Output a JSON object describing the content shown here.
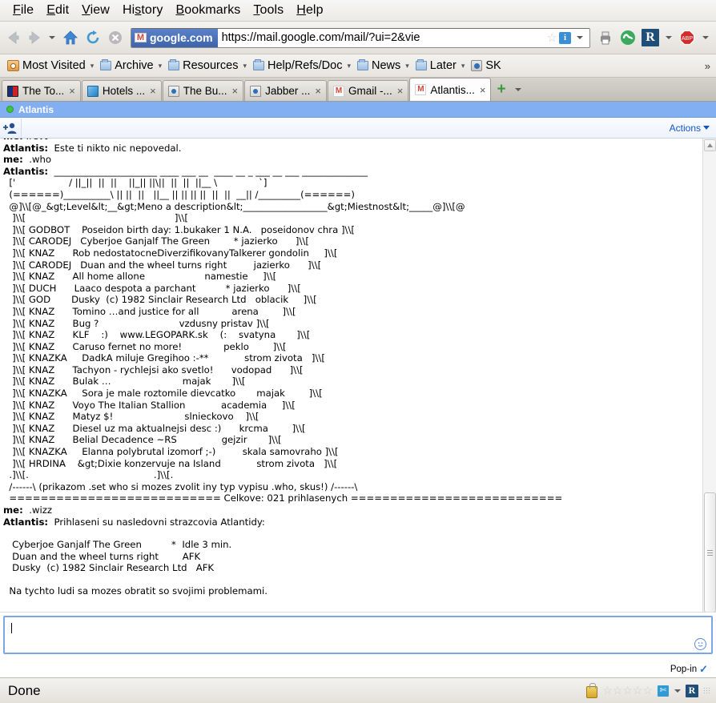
{
  "browser": {
    "menu": [
      "File",
      "Edit",
      "View",
      "History",
      "Bookmarks",
      "Tools",
      "Help"
    ],
    "url_identity": "google.com",
    "url": "https://mail.google.com/mail/?ui=2&vie",
    "bookmarks": [
      {
        "label": "Most Visited",
        "icon": "most-visited-icon",
        "caret": true
      },
      {
        "label": "Archive",
        "icon": "folder-icon",
        "caret": true
      },
      {
        "label": "Resources",
        "icon": "folder-icon",
        "caret": true
      },
      {
        "label": "Help/Refs/Doc",
        "icon": "folder-icon",
        "caret": true
      },
      {
        "label": "News",
        "icon": "folder-icon",
        "caret": true
      },
      {
        "label": "Later",
        "icon": "folder-icon",
        "caret": true
      },
      {
        "label": "SK",
        "icon": "site-icon",
        "caret": false
      }
    ],
    "bookmarks_overflow": "»",
    "tabs": [
      {
        "label": "The To...",
        "favicon": "tor-icon",
        "active": false
      },
      {
        "label": "Hotels ...",
        "favicon": "hotels-icon",
        "active": false
      },
      {
        "label": "The Bu...",
        "favicon": "generic-site-icon",
        "active": false
      },
      {
        "label": "Jabber ...",
        "favicon": "generic-site-icon",
        "active": false
      },
      {
        "label": "Gmail -...",
        "favicon": "gmail-icon",
        "active": false
      },
      {
        "label": "Atlantis...",
        "favicon": "gmail-icon",
        "active": true
      }
    ],
    "tab_close_glyph": "×",
    "new_tab_glyph": "+",
    "toolbar_buttons": [
      "print-icon",
      "stumbleupon-icon",
      "readability-icon",
      "adblock-plus-icon"
    ],
    "status": "Done"
  },
  "chat": {
    "title": "Atlantis",
    "presence": "online",
    "actions_label": "Actions",
    "invite_icon": "add-contact-icon",
    "popin_label": "Pop-in",
    "input_value": "",
    "input_placeholder": "",
    "smiley_icon": "emoticon-icon",
    "messages": [
      {
        "type": "msg",
        "who": "me:",
        "text": " .revt",
        "clipped": true
      },
      {
        "type": "msg",
        "who": "Atlantis:",
        "text": "  Este ti nikto nic nepovedal."
      },
      {
        "type": "msg",
        "who": "me:",
        "text": "  .who"
      },
      {
        "type": "msg",
        "who": "Atlantis:",
        "text": "  ______________________ ____ ___ __  ____ __ _ ___ __ ___ ______________"
      },
      {
        "type": "raw",
        "text": "  ['                  / ||_||  ||  ||    ||_|| ||\\||  ||  ||  ||__ \\              `]"
      },
      {
        "type": "raw",
        "text": "  (======)__________\\ || ||  ||   ||__ || || || ||  ||  ||  __|| /_________(======)"
      },
      {
        "type": "raw",
        "text": "  @]\\\\[@_&gt;Level&lt;__&gt;Meno a description&lt;__________________&gt;Miestnost&lt;_____@]\\\\[@"
      },
      {
        "type": "raw",
        "text": "   ]\\\\[                                                  ]\\\\["
      },
      {
        "type": "raw",
        "text": "   ]\\\\[ GODBOT    Poseidon birth day: 1.bukaker 1 N.A.   poseidonov chra ]\\\\["
      },
      {
        "type": "raw",
        "text": "   ]\\\\[ CARODEJ   Cyberjoe Ganjalf The Green        * jazierko      ]\\\\["
      },
      {
        "type": "raw",
        "text": "   ]\\\\[ KNAZ      Rob nedostatocneDiverzifikovanyTalkerer gondolin     ]\\\\["
      },
      {
        "type": "raw",
        "text": "   ]\\\\[ CARODEJ   Duan and the wheel turns right         jazierko      ]\\\\["
      },
      {
        "type": "raw",
        "text": "   ]\\\\[ KNAZ      All home allone                    namestie     ]\\\\["
      },
      {
        "type": "raw",
        "text": "   ]\\\\[ DUCH      Laaco despota a parchant          * jazierko      ]\\\\["
      },
      {
        "type": "raw",
        "text": "   ]\\\\[ GOD       Dusky  (c) 1982 Sinclair Research Ltd   oblacik     ]\\\\["
      },
      {
        "type": "raw",
        "text": "   ]\\\\[ KNAZ      Tomino …and justice for all           arena        ]\\\\["
      },
      {
        "type": "raw",
        "text": "   ]\\\\[ KNAZ      Bug ?                           vzdusny pristav ]\\\\["
      },
      {
        "type": "raw",
        "text": "   ]\\\\[ KNAZ      KLF    :)    www.LEGOPARK.sk    (:    svatyna       ]\\\\["
      },
      {
        "type": "raw",
        "text": "   ]\\\\[ KNAZ      Caruso fernet no more!              peklo        ]\\\\["
      },
      {
        "type": "raw",
        "text": "   ]\\\\[ KNAZKA     DadkA miluje Gregihoo :-**            strom zivota   ]\\\\["
      },
      {
        "type": "raw",
        "text": "   ]\\\\[ KNAZ      Tachyon - rychlejsi ako svetlo!      vodopad      ]\\\\["
      },
      {
        "type": "raw",
        "text": "   ]\\\\[ KNAZ      Bulak …                        majak       ]\\\\["
      },
      {
        "type": "raw",
        "text": "   ]\\\\[ KNAZKA     Sora je male roztomile dievcatko       majak        ]\\\\["
      },
      {
        "type": "raw",
        "text": "   ]\\\\[ KNAZ      Voyo The Italian Stallion            academia     ]\\\\["
      },
      {
        "type": "raw",
        "text": "   ]\\\\[ KNAZ      Matyz $!                        slnieckovo    ]\\\\["
      },
      {
        "type": "raw",
        "text": "   ]\\\\[ KNAZ      Diesel uz ma aktualnejsi desc :)      krcma        ]\\\\["
      },
      {
        "type": "raw",
        "text": "   ]\\\\[ KNAZ      Belial Decadence ~RS               gejzir       ]\\\\["
      },
      {
        "type": "raw",
        "text": "   ]\\\\[ KNAZKA     Elanna polybrutal izomorf ;-)         skala samovraho ]\\\\["
      },
      {
        "type": "raw",
        "text": "   ]\\\\[ HRDINA    &gt;Dixie konzervuje na Island            strom zivota   ]\\\\["
      },
      {
        "type": "raw",
        "text": "  .]\\\\[.                                          .]\\\\[."
      },
      {
        "type": "raw",
        "text": "  /------\\ (prikazom .set who si mozes zvolit iny typ vypisu .who, skus!) /------\\"
      },
      {
        "type": "raw",
        "text": "  =========================== Celkove: 021 prihlasenych ==========================="
      },
      {
        "type": "msg",
        "who": "me:",
        "text": "  .wizz"
      },
      {
        "type": "msg",
        "who": "Atlantis:",
        "text": "  Prihlaseni su nasledovni strazcovia Atlantidy:"
      },
      {
        "type": "spacer"
      },
      {
        "type": "raw",
        "text": "   Cyberjoe Ganjalf The Green          *  Idle 3 min."
      },
      {
        "type": "raw",
        "text": "   Duan and the wheel turns right        AFK"
      },
      {
        "type": "raw",
        "text": "   Dusky  (c) 1982 Sinclair Research Ltd   AFK"
      },
      {
        "type": "spacer"
      },
      {
        "type": "raw",
        "text": "  Na tychto ludi sa mozes obratit so svojimi problemami."
      }
    ]
  },
  "colors": {
    "chat_header_bg": "#82aef2",
    "link": "#1155cc",
    "identity_bg": "#4a6fb5",
    "presence_green": "#3ec43e",
    "input_border": "#7ba7e8"
  }
}
